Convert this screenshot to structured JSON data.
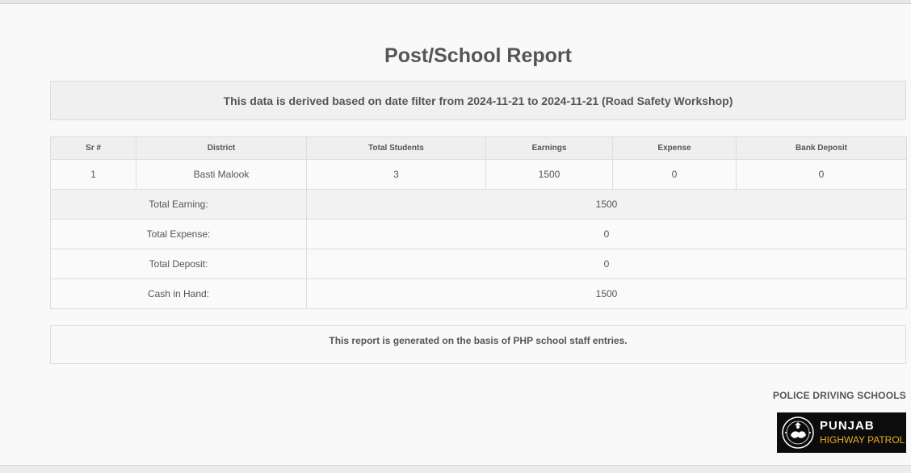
{
  "page_title": "Post/School Report",
  "filter_banner": "This data is derived based on date filter from 2024-11-21 to 2024-11-21 (Road Safety Workshop)",
  "table": {
    "columns": [
      "Sr #",
      "District",
      "Total Students",
      "Earnings",
      "Expense",
      "Bank Deposit"
    ],
    "rows": [
      {
        "sr": "1",
        "district": "Basti Malook",
        "total_students": "3",
        "earnings": "1500",
        "expense": "0",
        "bank_deposit": "0"
      }
    ],
    "summary": [
      {
        "label": "Total Earning:",
        "value": "1500"
      },
      {
        "label": "Total Expense:",
        "value": "0"
      },
      {
        "label": "Total Deposit:",
        "value": "0"
      },
      {
        "label": "Cash in Hand:",
        "value": "1500"
      }
    ]
  },
  "footer_note": "This report is generated on the basis of PHP school staff entries.",
  "branding": {
    "org_label": "POLICE DRIVING SCHOOLS",
    "logo_line1": "PUNJAB",
    "logo_line2": "HIGHWAY PATROL",
    "logo_icon": "php-badge-icon",
    "logo_accent": "#e8ab1e"
  },
  "colors": {
    "text": "#555555",
    "header_bg": "#efefef",
    "border": "#dddddd",
    "page_bg": "#f9f9f9"
  }
}
